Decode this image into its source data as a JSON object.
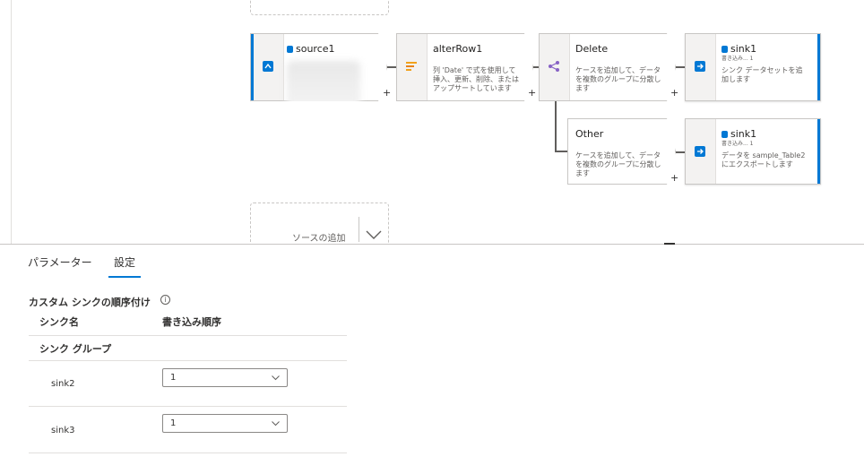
{
  "flow": {
    "source": {
      "title": "source1"
    },
    "alterRow": {
      "title": "alterRow1",
      "desc": "列 'Date' で式を使用して挿入、更新、削除、またはアップサートしています"
    },
    "split_delete": {
      "title": "Delete",
      "desc": "ケースを追加して、データを複数のグループに分散します"
    },
    "split_other": {
      "title": "Other",
      "desc": "ケースを追加して、データを複数のグループに分散します"
    },
    "sink_top": {
      "title": "sink1",
      "sub": "書き込み... 1",
      "desc": "シンク データセットを追加します"
    },
    "sink_bottom": {
      "title": "sink1",
      "sub": "書き込み... 1",
      "desc": "データを sample_Table2 にエクスポートします"
    },
    "add_source_label": "ソースの追加",
    "plus": "+"
  },
  "tabs": [
    {
      "label": "パラメーター"
    },
    {
      "label": "設定"
    }
  ],
  "settings": {
    "section_title": "カスタム シンクの順序付け",
    "info": "i",
    "col_sink_name": "シンク名",
    "col_write_order": "書き込み順序",
    "group_label": "シンク グループ",
    "rows": [
      {
        "name": "sink2",
        "order": "1"
      },
      {
        "name": "sink3",
        "order": "1"
      }
    ]
  },
  "colors": {
    "accent": "#0078d4",
    "alter": "#f2a21c",
    "split": "#8661c5"
  }
}
